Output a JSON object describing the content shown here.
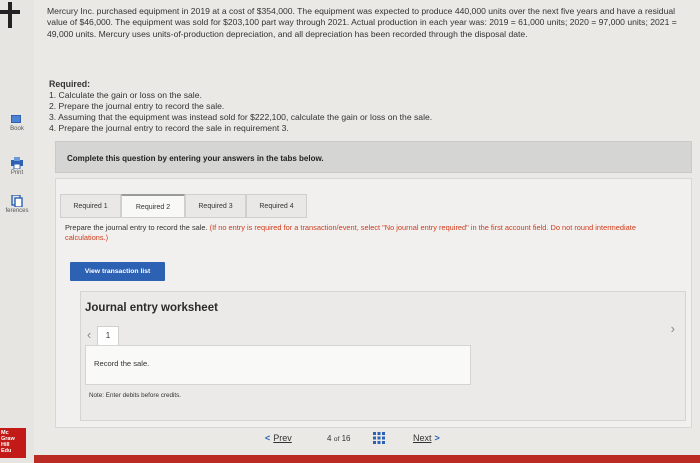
{
  "problem": {
    "text": "Mercury Inc. purchased equipment in 2019 at a cost of $354,000. The equipment was expected to produce 440,000 units over the next five years and have a residual value of $46,000. The equipment was sold for $203,100 part way through 2021. Actual production in each year was: 2019 = 61,000 units; 2020 = 97,000 units; 2021 = 49,000 units. Mercury uses units-of-production depreciation, and all depreciation has been recorded through the disposal date."
  },
  "required": {
    "heading": "Required:",
    "items": [
      "1. Calculate the gain or loss on the sale.",
      "2. Prepare the journal entry to record the sale.",
      "3. Assuming that the equipment was instead sold for $222,100, calculate the gain or loss on the sale.",
      "4. Prepare the journal entry to record the sale in requirement 3."
    ]
  },
  "sidebar": {
    "book": "Book",
    "print": "Print",
    "references": "ferences",
    "logo": "Mc Graw Hill Education"
  },
  "complete_banner": "Complete this question by entering your answers in the tabs below.",
  "tabs": [
    {
      "label": "Required 1"
    },
    {
      "label": "Required 2"
    },
    {
      "label": "Required 3"
    },
    {
      "label": "Required 4"
    }
  ],
  "instructions": {
    "main": "Prepare the journal entry to record the sale.",
    "note": "(If no entry is required for a transaction/event, select \"No journal entry required\" in the first account field. Do not round intermediate calculations.)"
  },
  "view_transaction_button": "View transaction list",
  "journal": {
    "title": "Journal entry worksheet",
    "entry_number": "1",
    "record_text": "Record the sale.",
    "note": "Note: Enter debits before credits."
  },
  "navigation": {
    "prev": "Prev",
    "page_current": "4",
    "page_of": "of",
    "page_total": "16",
    "next": "Next"
  },
  "colors": {
    "accent": "#2d61b3",
    "brand_red": "#bb2a23",
    "note_red": "#d03a1a"
  }
}
